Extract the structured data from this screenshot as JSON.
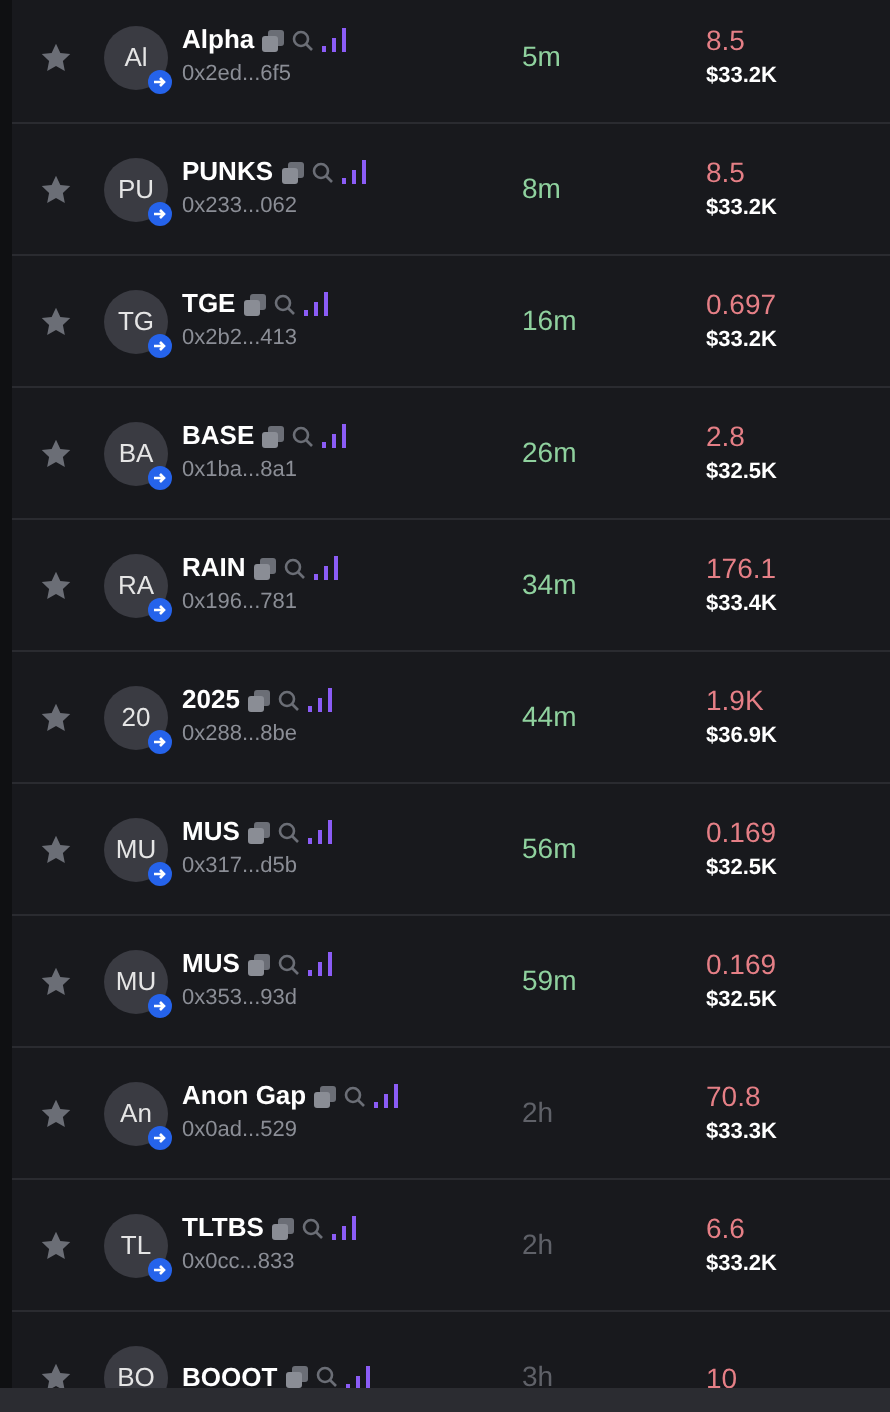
{
  "tokens": [
    {
      "name": "Alpha",
      "initials": "Al",
      "address": "0x2ed...6f5",
      "age": "5m",
      "fresh": true,
      "price": "8.5",
      "mcap": "$33.2K"
    },
    {
      "name": "PUNKS",
      "initials": "PU",
      "address": "0x233...062",
      "age": "8m",
      "fresh": true,
      "price": "8.5",
      "mcap": "$33.2K"
    },
    {
      "name": "TGE",
      "initials": "TG",
      "address": "0x2b2...413",
      "age": "16m",
      "fresh": true,
      "price": "0.697",
      "mcap": "$33.2K"
    },
    {
      "name": "BASE",
      "initials": "BA",
      "address": "0x1ba...8a1",
      "age": "26m",
      "fresh": true,
      "price": "2.8",
      "mcap": "$32.5K"
    },
    {
      "name": "RAIN",
      "initials": "RA",
      "address": "0x196...781",
      "age": "34m",
      "fresh": true,
      "price": "176.1",
      "mcap": "$33.4K"
    },
    {
      "name": "2025",
      "initials": "20",
      "address": "0x288...8be",
      "age": "44m",
      "fresh": true,
      "price": "1.9K",
      "mcap": "$36.9K"
    },
    {
      "name": "MUS",
      "initials": "MU",
      "address": "0x317...d5b",
      "age": "56m",
      "fresh": true,
      "price": "0.169",
      "mcap": "$32.5K"
    },
    {
      "name": "MUS",
      "initials": "MU",
      "address": "0x353...93d",
      "age": "59m",
      "fresh": true,
      "price": "0.169",
      "mcap": "$32.5K"
    },
    {
      "name": "Anon Gap",
      "initials": "An",
      "address": "0x0ad...529",
      "age": "2h",
      "fresh": false,
      "price": "70.8",
      "mcap": "$33.3K"
    },
    {
      "name": "TLTBS",
      "initials": "TL",
      "address": "0x0cc...833",
      "age": "2h",
      "fresh": false,
      "price": "6.6",
      "mcap": "$33.2K"
    },
    {
      "name": "BOOOT",
      "initials": "BO",
      "age": "3h",
      "fresh": false,
      "price": "10"
    }
  ]
}
